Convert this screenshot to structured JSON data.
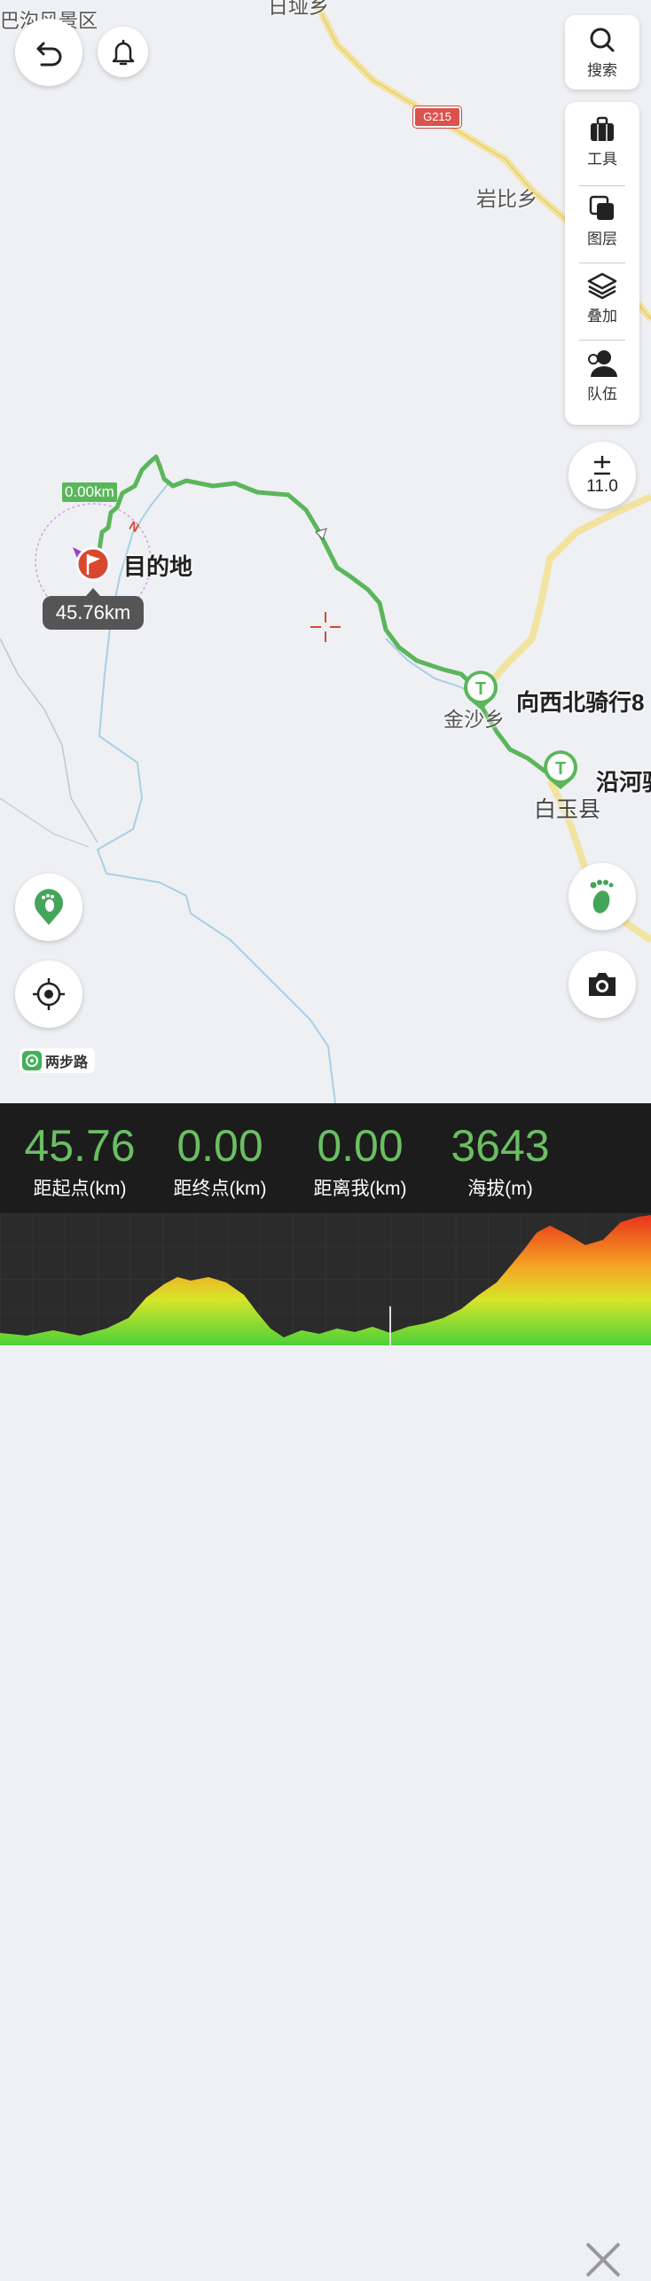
{
  "map": {
    "places": {
      "top_left": "巴沟风景区",
      "top_center": "日垭乡",
      "yanbi": "岩比乡",
      "jinsha": "金沙乡",
      "baiyu": "白玉县"
    },
    "road_sign": "G215",
    "zoom_level": "11.0",
    "start_distance_tag": "0.00km",
    "destination": {
      "label": "目的地",
      "distance": "45.76km",
      "compass": "N"
    },
    "waypoints": [
      {
        "label": "向西北骑行8",
        "icon": "T"
      },
      {
        "label": "沿河骑",
        "icon": "T"
      }
    ],
    "brand": "两步路"
  },
  "toolbar": {
    "search": "搜索",
    "tools": "工具",
    "layers": "图层",
    "overlay": "叠加",
    "team": "队伍"
  },
  "stats": [
    {
      "value": "45.76",
      "label": "距起点(km)"
    },
    {
      "value": "0.00",
      "label": "距终点(km)"
    },
    {
      "value": "0.00",
      "label": "距离我(km)"
    },
    {
      "value": "3643",
      "label": "海拔(m)"
    }
  ],
  "colors": {
    "route": "#5bb65b",
    "stat_value": "#6abf62",
    "panel_bg": "#1c1c1c",
    "destination": "#d9472f"
  }
}
